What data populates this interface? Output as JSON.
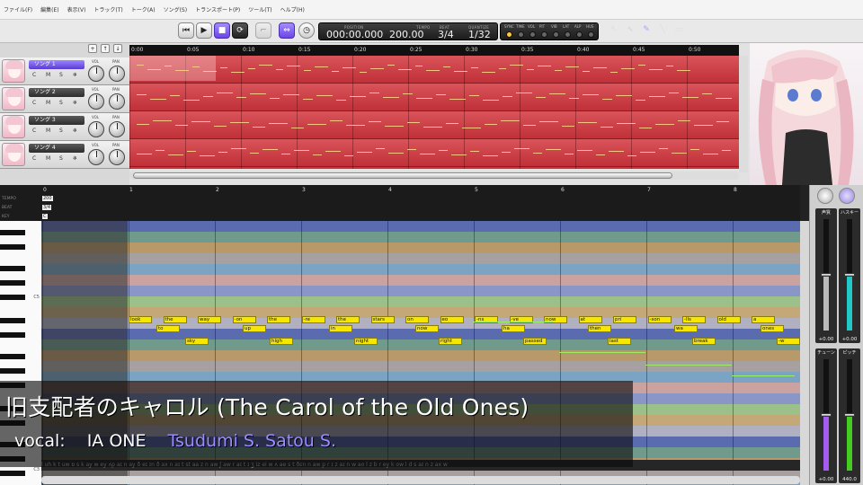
{
  "menu": [
    "ファイル(F)",
    "編集(E)",
    "表示(V)",
    "トラック(T)",
    "トーク(A)",
    "ソング(S)",
    "トランスポート(P)",
    "ツール(T)",
    "ヘルプ(H)"
  ],
  "transport": {
    "labels": {
      "position": "POSITION",
      "tempo": "TEMPO",
      "beat": "BEAT",
      "quantize": "QUANTIZE"
    },
    "position": "000:00.000",
    "tempo": "200.00",
    "beat": "3/4",
    "quantize": "1/32"
  },
  "led_labels": [
    "SYNC",
    "TIME",
    "VOL",
    "PIT",
    "VIB",
    "LAT",
    "ALP",
    "HUS"
  ],
  "tracks": [
    {
      "name": "ソング 1",
      "selected": true,
      "buttons": [
        "C",
        "M",
        "S",
        "❄"
      ],
      "vol_label": "VOL",
      "pan_label": "PAN"
    },
    {
      "name": "ソング 2",
      "selected": false,
      "buttons": [
        "C",
        "M",
        "S",
        "❄"
      ],
      "vol_label": "VOL",
      "pan_label": "PAN"
    },
    {
      "name": "ソング 3",
      "selected": false,
      "buttons": [
        "C",
        "M",
        "S",
        "❄"
      ],
      "vol_label": "VOL",
      "pan_label": "PAN"
    },
    {
      "name": "ソング 4",
      "selected": false,
      "buttons": [
        "C",
        "M",
        "S",
        "❄"
      ],
      "vol_label": "VOL",
      "pan_label": "PAN"
    }
  ],
  "track_ruler": [
    "0:00",
    "0:05",
    "0:10",
    "0:15",
    "0:20",
    "0:25",
    "0:30",
    "0:35",
    "0:40",
    "0:45",
    "0:50"
  ],
  "roll_rows": {
    "tempo": "TEMPO",
    "beat": "BEAT",
    "key": "KEY",
    "tempo_val": "200",
    "beat_val": "3/4",
    "key_val": "C"
  },
  "measures": [
    "0",
    "1",
    "2",
    "3",
    "4",
    "5",
    "6",
    "7",
    "8"
  ],
  "key_labels": {
    "upper": "C5",
    "lower": "C3"
  },
  "notes_top": [
    "look",
    "the",
    "way",
    "-on",
    "the",
    "-re",
    "the",
    "stars",
    "on",
    "eo",
    "-ns",
    "-ve",
    "now",
    "at",
    "pri",
    "-son",
    "-lls",
    "old",
    "a"
  ],
  "notes_mid": [
    "to",
    "up",
    "in",
    "now",
    "ha",
    "then",
    "wa",
    "ones"
  ],
  "notes_low": [
    "sky",
    "high",
    "night",
    "right",
    "passed",
    "last",
    "break",
    "-w"
  ],
  "phonemes": "l uh  k  t  uw ɒ s  k ay   w ey   ʌp  aɪ n ay   ð eɪ   ɪn  ð ax  n aɪ  t   st aa  z  n aw  ʃ aw   r aɪ t  ɪ ʒ iz ei   w ʌ  ae s  t   ðɛn  n aw   p r ɪ z  aɪ n  w ao   l z  b r ey  k   ow   l d  s aɪ n z  ax  w",
  "sliders": [
    {
      "name": "声質",
      "value": "+0.00",
      "level": 0.5,
      "color": "#bbbbbb"
    },
    {
      "name": "ハスキー",
      "value": "+0.00",
      "level": 0.5,
      "color": "#22c7c7"
    },
    {
      "name": "チューン",
      "value": "+0.00",
      "level": 0.5,
      "color": "#a45cf0"
    },
    {
      "name": "ピッチ",
      "value": "440.0",
      "level": 0.5,
      "color": "#44cc22"
    }
  ],
  "overlay": {
    "title": "旧支配者のキャロル (The Carol of the Old Ones)",
    "vocal_label": "vocal:",
    "vocal_name": "IA ONE",
    "credit_name": "Tsudumi S. Satou S."
  },
  "colors": {
    "track_lane": "#c8333c",
    "note": "#f7e600",
    "accent": "#7b5cf0"
  }
}
